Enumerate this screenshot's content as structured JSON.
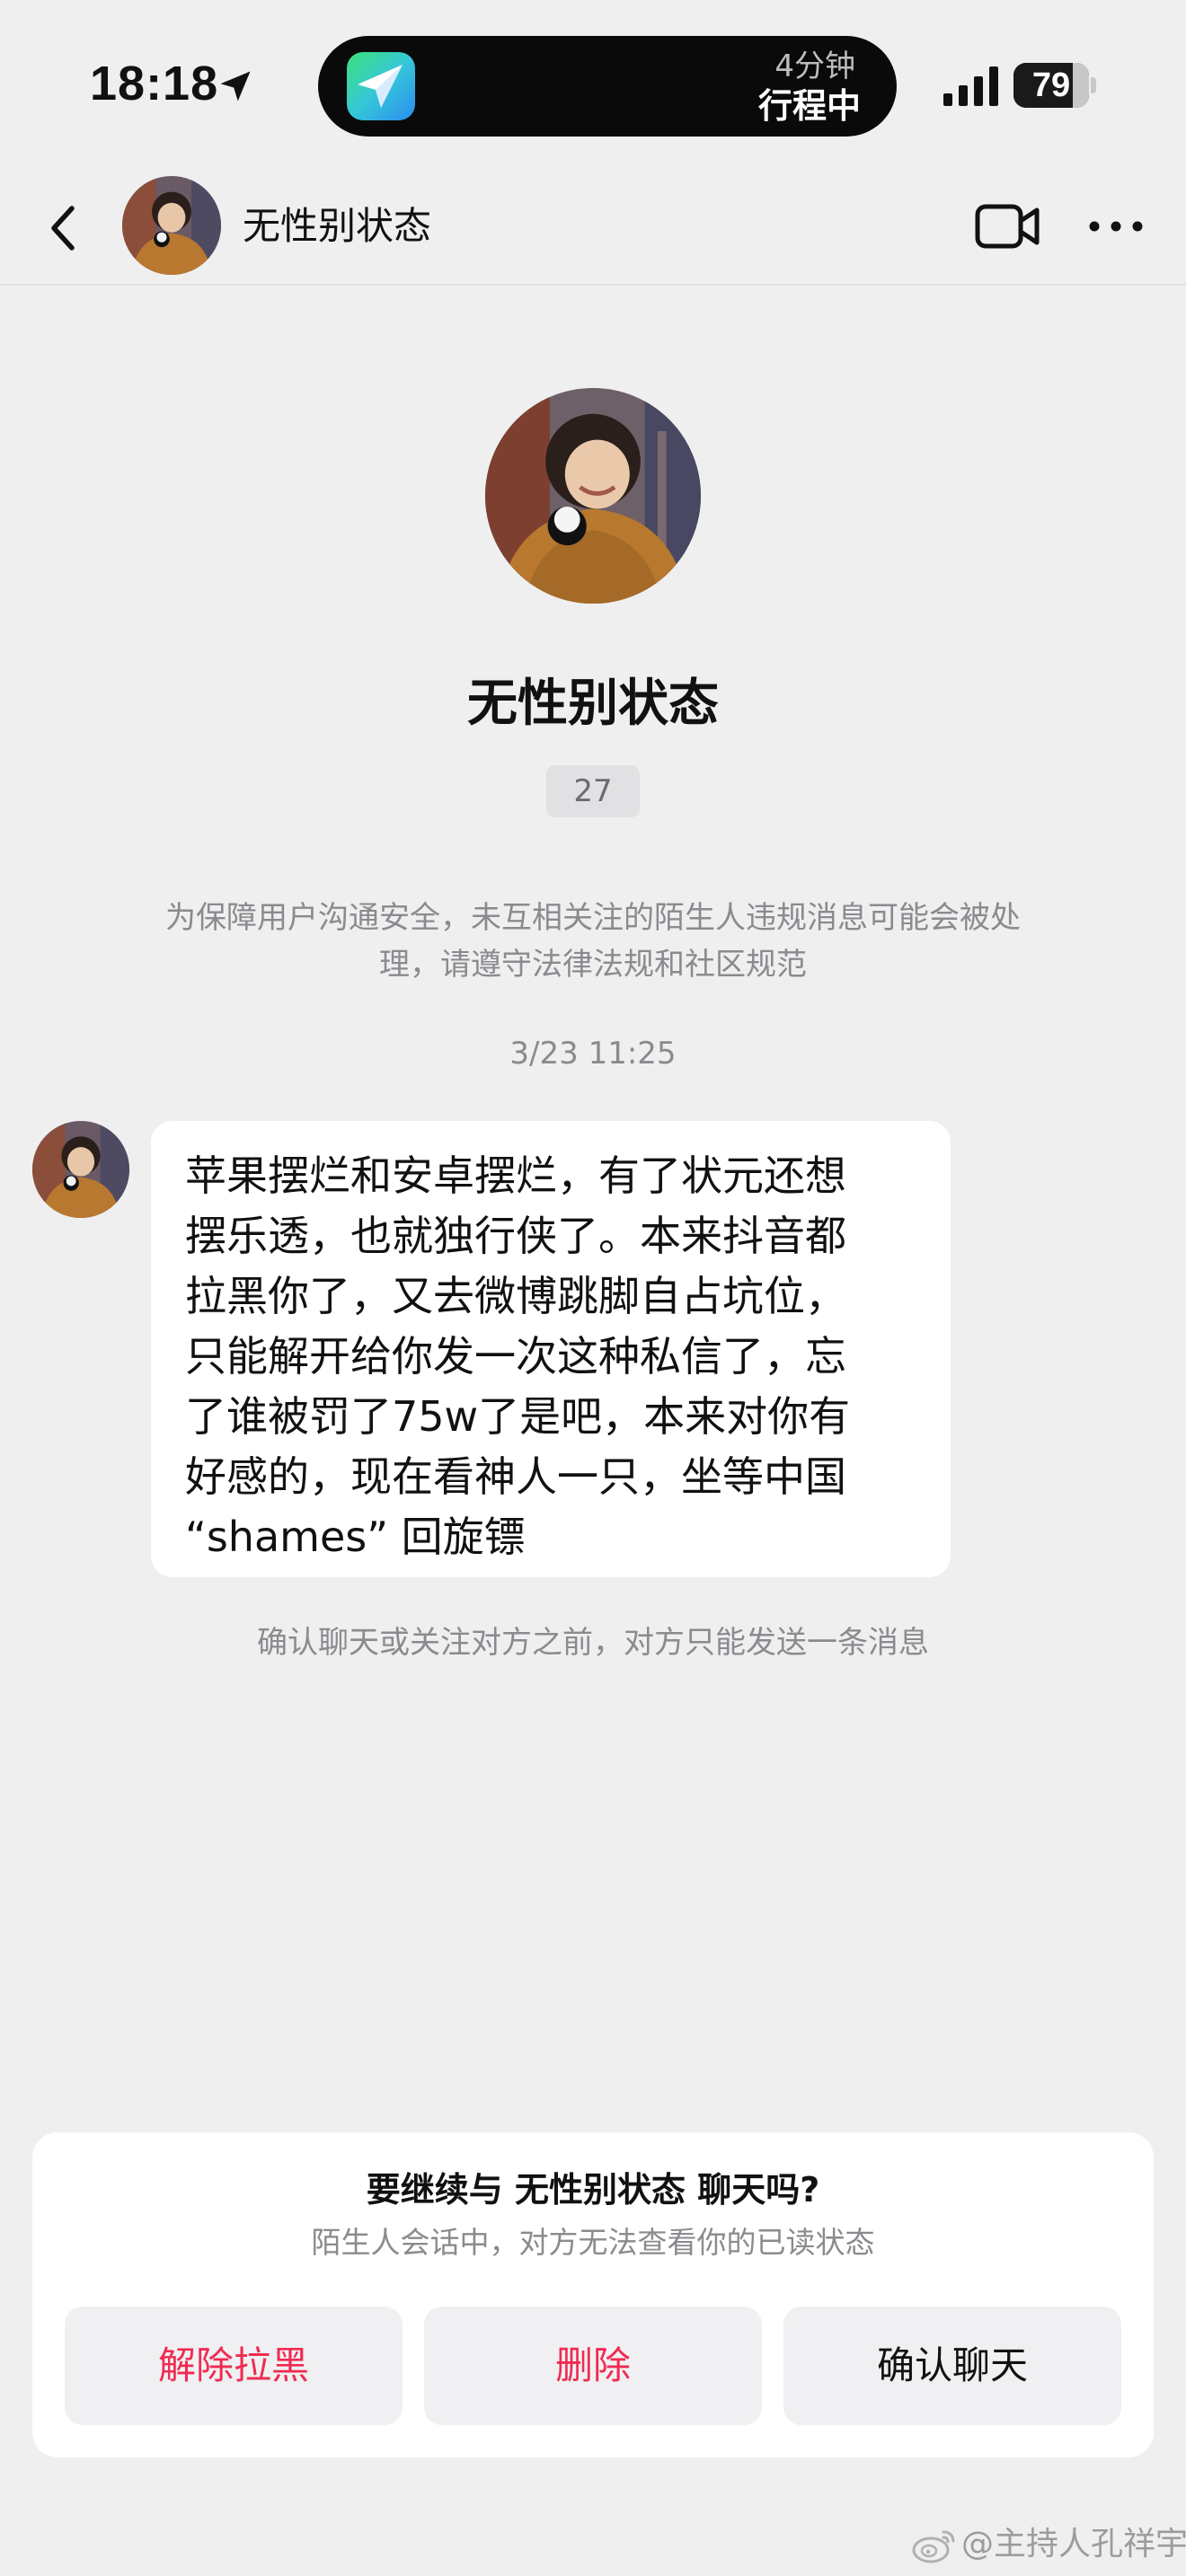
{
  "status_bar": {
    "time": "18:18",
    "island_eta": "4分钟",
    "island_status": "行程中",
    "battery_level": "79",
    "battery_fraction": 0.79
  },
  "header": {
    "contact_name": "无性别状态"
  },
  "profile": {
    "name": "无性别状态",
    "badge": "27"
  },
  "chat": {
    "safety_notice": "为保障用户沟通安全，未互相关注的陌生人违规消息可能会被处\n理，请遵守法律法规和社区规范",
    "timestamp": "3/23 11:25",
    "message_text": "苹果摆烂和安卓摆烂，有了状元还想\n摆乐透，也就独行侠了。本来抖音都\n拉黑你了，又去微博跳脚自占坑位，\n只能解开给你发一次这种私信了，忘\n了谁被罚了75w了是吧，本来对你有\n好感的，现在看神人一只，坐等中国\n“shames” 回旋镖",
    "limit_notice": "确认聊天或关注对方之前，对方只能发送一条消息"
  },
  "prompt": {
    "title": "要继续与 无性别状态 聊天吗?",
    "subtitle": "陌生人会话中，对方无法查看你的已读状态",
    "unblock_label": "解除拉黑",
    "delete_label": "删除",
    "confirm_label": "确认聊天"
  },
  "watermark": {
    "text": "@主持人孔祥宇"
  },
  "colors": {
    "page_background": "#efeff0",
    "danger": "#f02b53",
    "muted_text": "#8a8a8f",
    "button_background": "#f0f0f2"
  },
  "icons": {
    "back": "chevron-left-icon",
    "video": "video-camera-icon",
    "more": "more-dots-icon",
    "location": "location-arrow-icon",
    "signal": "cellular-signal-icon",
    "nav_app": "paper-plane-icon",
    "watermark_logo": "weibo-logo"
  }
}
